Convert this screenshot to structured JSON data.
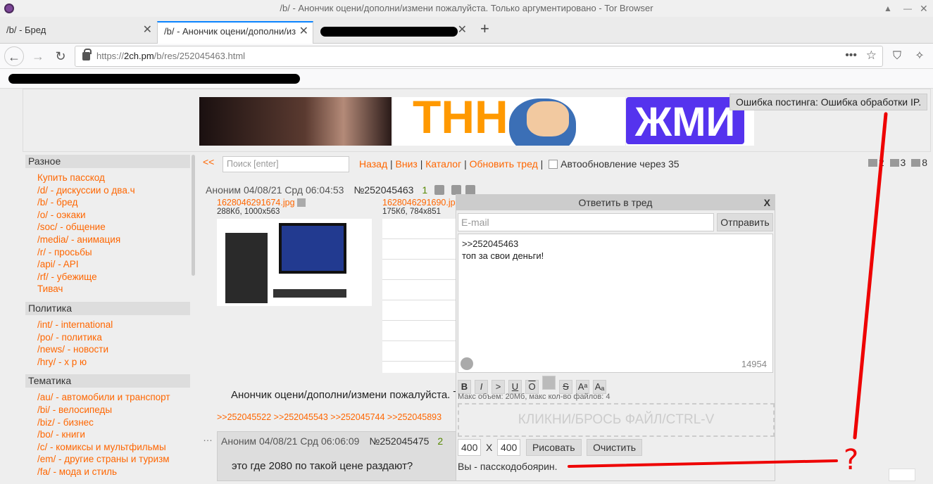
{
  "window": {
    "title": "/b/ - Анончик оцени/дополни/измени пожалуйста. Только аргументировано - Tor Browser"
  },
  "tabs": [
    {
      "label": "/b/ - Бред"
    },
    {
      "label": "/b/ - Анончик оцени/дополни/из"
    }
  ],
  "address": {
    "prefix": "https://",
    "host": "2ch.pm",
    "path": "/b/res/252045463.html"
  },
  "banner": {
    "text1": "ТНН",
    "text2": "ЖМИ"
  },
  "error": "Ошибка постинга: Ошибка обработки IP.",
  "sidebar": [
    {
      "title": "Разное",
      "items": [
        "Купить пасскод",
        "/d/ - дискуссии о два.ч",
        "/b/ - бред",
        "/o/ - оэкаки",
        "/soc/ - общение",
        "/media/ - анимация",
        "/r/ - просьбы",
        "/api/ - API",
        "/rf/ - убежище",
        "Тивач"
      ]
    },
    {
      "title": "Политика",
      "items": [
        "/int/ - international",
        "/po/ - политика",
        "/news/ - новости",
        "/hry/ - х р ю"
      ]
    },
    {
      "title": "Тематика",
      "items": [
        "/au/ - автомобили и транспорт",
        "/bi/ - велосипеды",
        "/biz/ - бизнес",
        "/bo/ - книги",
        "/c/ - комиксы и мультфильмы",
        "/em/ - другие страны и туризм",
        "/fa/ - мода и стиль"
      ]
    }
  ],
  "controls": {
    "back": "<<",
    "search_placeholder": "Поиск [enter]",
    "nav_back": "Назад",
    "nav_down": "Вниз",
    "nav_catalog": "Каталог",
    "nav_refresh": "Обновить тред",
    "autoupdate": "Автообновление через 35",
    "stat_posts": "2",
    "stat_images": "3",
    "stat_users": "8"
  },
  "op": {
    "author": "Аноним",
    "date": "04/08/21 Срд 06:04:53",
    "num": "№252045463",
    "count": "1",
    "file1_name": "1628046291674.jpg",
    "file1_info": "288Кб, 1000x563",
    "file2_name": "1628046291690.jp",
    "file2_info": "175Кб, 784x851",
    "text": "Анончик оцени/дополни/измени пожалуйста. Т",
    "replies": ">>252045522 >>252045543 >>252045744 >>252045893"
  },
  "post2": {
    "author": "Аноним",
    "date": "04/08/21 Срд 06:06:09",
    "num": "№252045475",
    "count": "2",
    "text": "это где 2080 по такой цене раздают?"
  },
  "reply_form": {
    "title": "Ответить в тред",
    "close": "X",
    "email_placeholder": "E-mail",
    "send": "Отправить",
    "message_line1": ">>252045463",
    "message_line2": "топ за свои деньги!",
    "counter": "14954",
    "format_buttons": [
      "B",
      "I",
      ">",
      "U",
      "O",
      "",
      "S",
      "Aᵃ",
      "Aₐ"
    ],
    "max_info": "Макс объем: 20Мб, макс кол-во файлов: 4",
    "drop_zone": "КЛИКНИ/БРОСЬ ФАЙЛ/CTRL-V",
    "width": "400",
    "x": "X",
    "height": "400",
    "draw": "Рисовать",
    "clear": "Очистить",
    "passcode": "Вы - пасскодобоярин."
  },
  "annotation": {
    "mark": "?",
    "color": "#ee0000"
  },
  "colors": {
    "link": "#ff6600",
    "tab_accent": "#0a84ff",
    "tor": "#7d4698"
  }
}
